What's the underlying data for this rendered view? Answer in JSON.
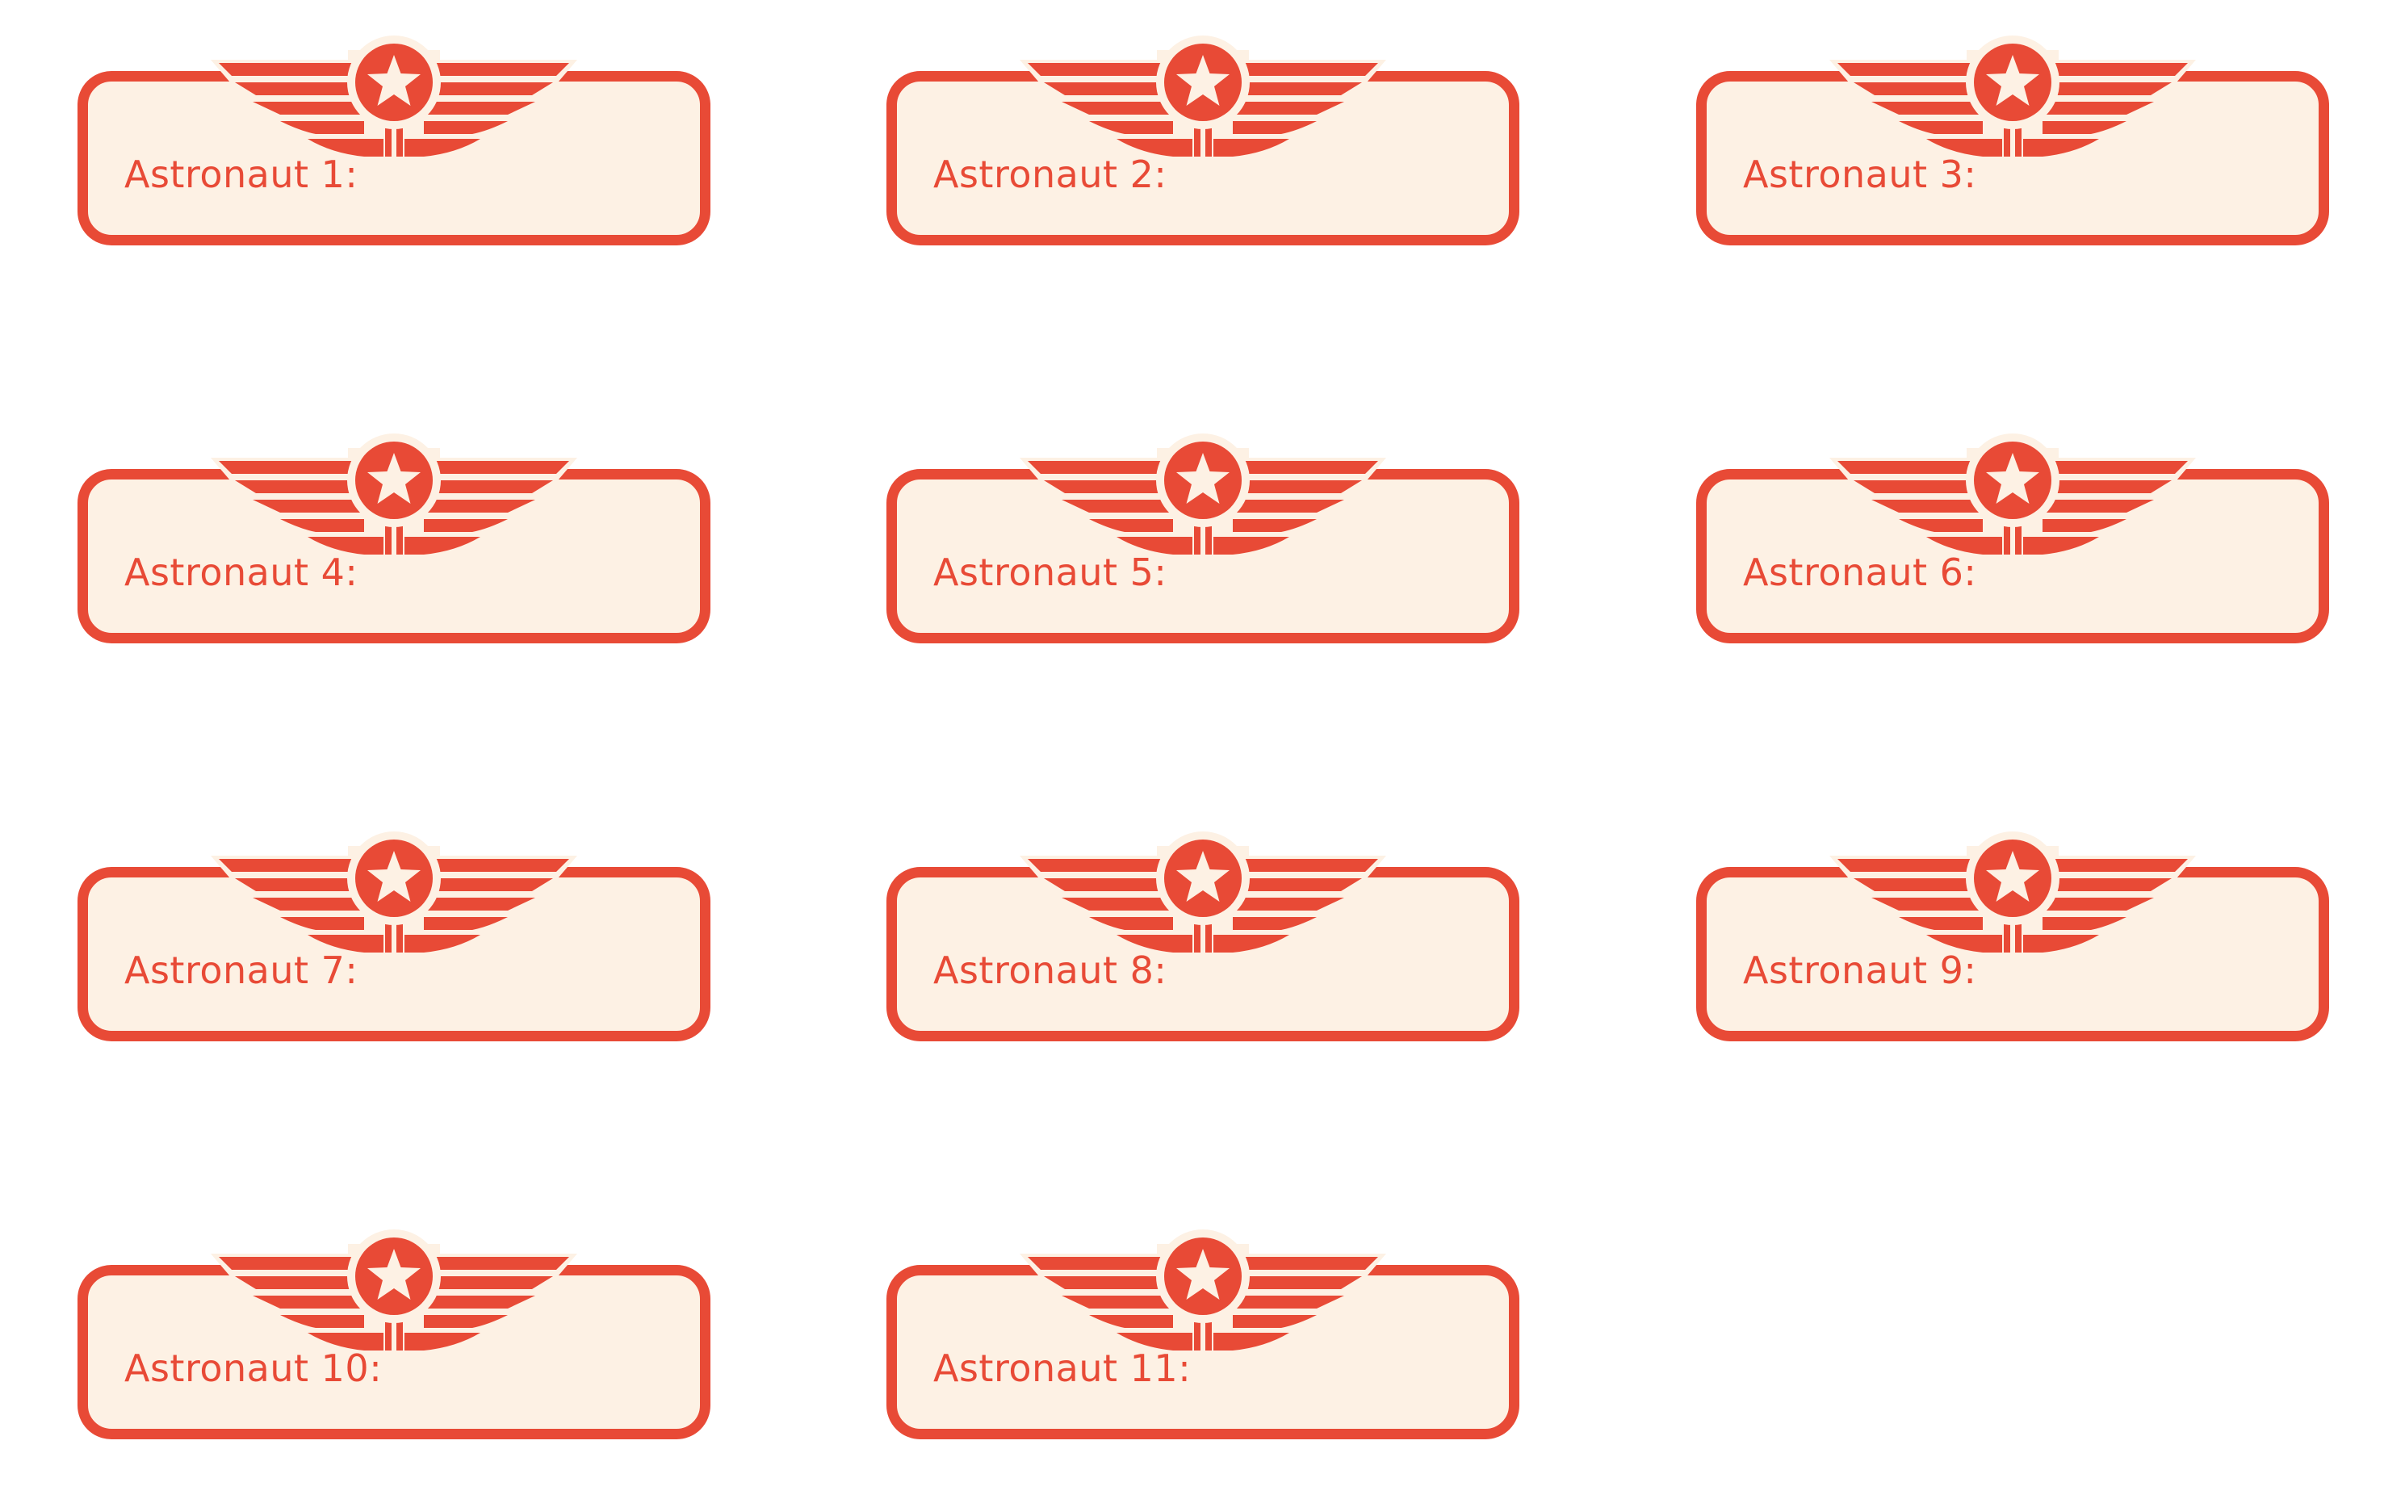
{
  "colors": {
    "accent": "#e84a36",
    "card_fill": "#fdf1e4",
    "background": "#ffffff"
  },
  "badges": [
    {
      "label": "Astronaut 1:",
      "icon": "winged-star-emblem-icon"
    },
    {
      "label": "Astronaut 2:",
      "icon": "winged-star-emblem-icon"
    },
    {
      "label": "Astronaut 3:",
      "icon": "winged-star-emblem-icon"
    },
    {
      "label": "Astronaut 4:",
      "icon": "winged-star-emblem-icon"
    },
    {
      "label": "Astronaut 5:",
      "icon": "winged-star-emblem-icon"
    },
    {
      "label": "Astronaut 6:",
      "icon": "winged-star-emblem-icon"
    },
    {
      "label": "Astronaut 7:",
      "icon": "winged-star-emblem-icon"
    },
    {
      "label": "Astronaut 8:",
      "icon": "winged-star-emblem-icon"
    },
    {
      "label": "Astronaut 9:",
      "icon": "winged-star-emblem-icon"
    },
    {
      "label": "Astronaut 10:",
      "icon": "winged-star-emblem-icon"
    },
    {
      "label": "Astronaut 11:",
      "icon": "winged-star-emblem-icon"
    }
  ]
}
